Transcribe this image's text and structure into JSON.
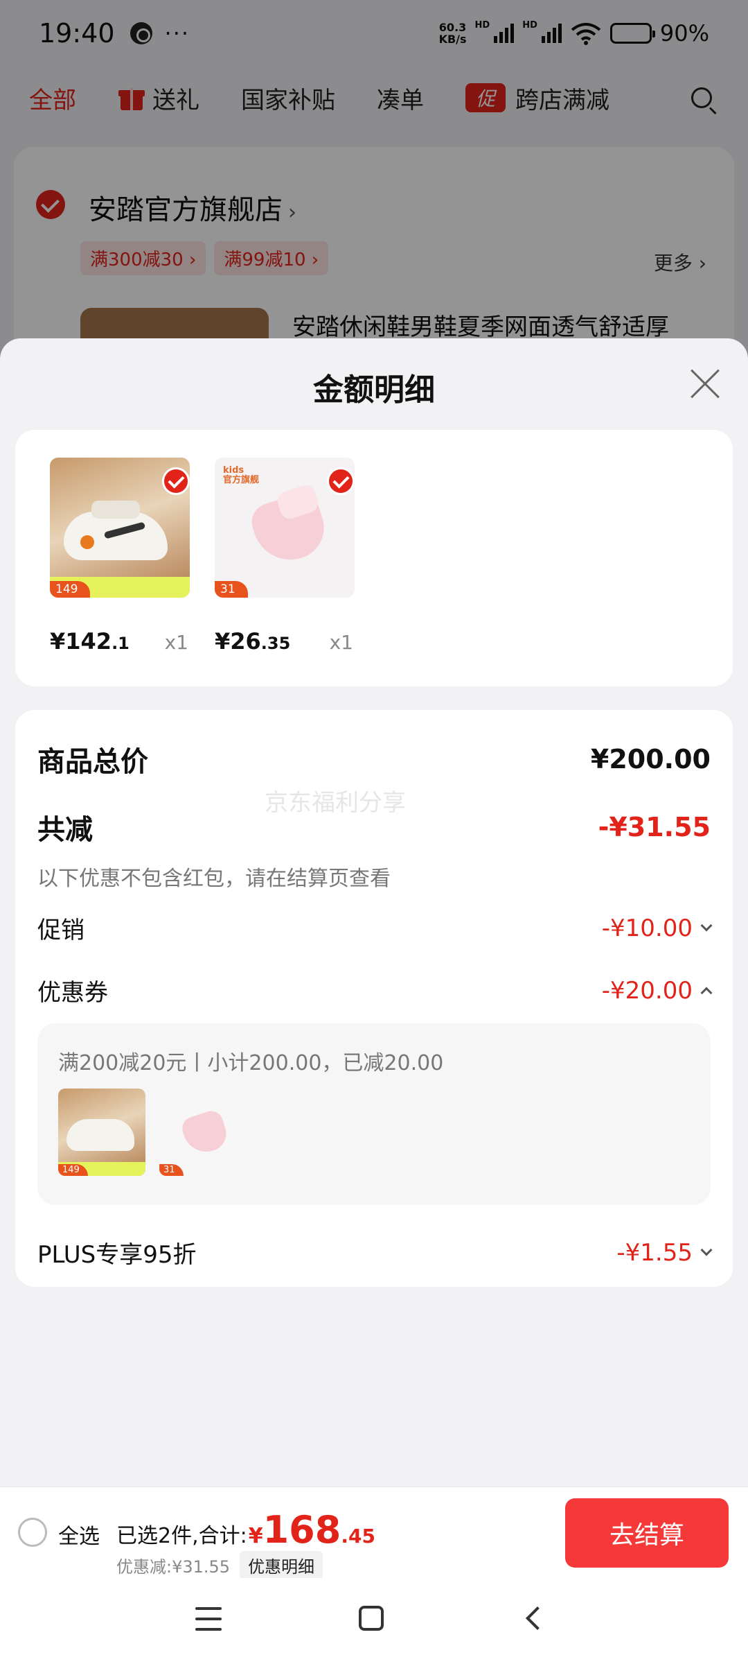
{
  "status_bar": {
    "time": "19:40",
    "more": "···",
    "net_speed_value": "60.3",
    "net_speed_unit": "KB/s",
    "hd_label": "HD",
    "battery": "90%",
    "icons": [
      "app-notification-icon",
      "signal-icon",
      "wifi-icon",
      "battery-icon"
    ]
  },
  "tabs": [
    {
      "label": "全部",
      "active": true
    },
    {
      "label": "送礼",
      "icon": "gift-icon"
    },
    {
      "label": "国家补贴"
    },
    {
      "label": "凑单"
    },
    {
      "label": "跨店满减",
      "badge": "促"
    }
  ],
  "store": {
    "name": "安踏官方旗舰店",
    "name_arrow": "›",
    "tags": [
      "满300减30 ›",
      "满99减10 ›"
    ],
    "more": "更多 ›",
    "product_title": "安踏休闲鞋男鞋夏季网面透气舒适厚"
  },
  "sheet": {
    "title": "金额明细",
    "items": [
      {
        "price_int": "¥142",
        "price_dec": ".1",
        "qty": "x1",
        "tag": "149",
        "image": "white-sneaker"
      },
      {
        "price_int": "¥26",
        "price_dec": ".35",
        "qty": "x1",
        "tag": "31",
        "image": "pink-sock",
        "logo_line1": "kids",
        "logo_line2": "官方旗舰"
      }
    ],
    "summary": {
      "total_label": "商品总价",
      "total_value": "¥200.00",
      "discount_label": "共减",
      "discount_value": "-¥31.55",
      "note": "以下优惠不包含红包，请在结算页查看",
      "watermark": "京东福利分享",
      "promo_label": "促销",
      "promo_value": "-¥10.00",
      "coupon_label": "优惠券",
      "coupon_value": "-¥20.00",
      "coupon_detail": "满200减20元丨小计200.00，已减20.00",
      "coupon_thumb_tags": [
        "149",
        "31"
      ],
      "plus_label": "PLUS专享95折",
      "plus_value": "-¥1.55"
    }
  },
  "bottom_bar": {
    "select_all": "全选",
    "selected_text": "已选2件,合计:",
    "currency": "¥",
    "total_int": "168",
    "total_dec": ".45",
    "discount_text": "优惠减:¥31.55",
    "detail_button": "优惠明细",
    "checkout_button": "去结算"
  },
  "colors": {
    "accent_red": "#e2231a",
    "checkout_red": "#f53939",
    "background": "#f2f2f4"
  }
}
